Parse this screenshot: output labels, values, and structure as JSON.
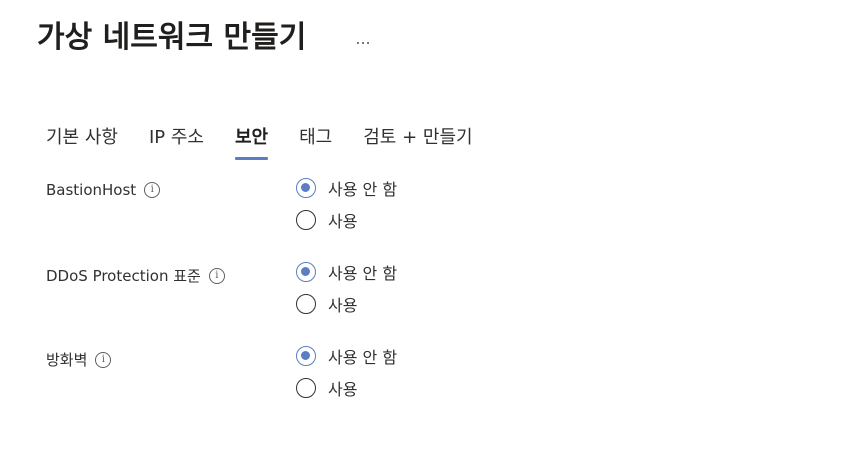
{
  "page": {
    "title": "가상 네트워크 만들기",
    "more_label": "..."
  },
  "tabs": [
    {
      "label": "기본 사항"
    },
    {
      "label": "IP 주소"
    },
    {
      "label": "보안"
    },
    {
      "label": "태그"
    },
    {
      "label": "검토 + 만들기"
    }
  ],
  "active_tab": "보안",
  "settings": [
    {
      "label": "BastionHost",
      "options": [
        {
          "label": "사용 안 함",
          "selected": true
        },
        {
          "label": "사용",
          "selected": false
        }
      ]
    },
    {
      "label": "DDoS Protection 표준",
      "options": [
        {
          "label": "사용 안 함",
          "selected": true
        },
        {
          "label": "사용",
          "selected": false
        }
      ]
    },
    {
      "label": "방화벽",
      "options": [
        {
          "label": "사용 안 함",
          "selected": true
        },
        {
          "label": "사용",
          "selected": false
        }
      ]
    }
  ],
  "icons": {
    "info": "info-icon",
    "more": "more-horizontal-icon"
  },
  "colors": {
    "accent": "#5b7dc6",
    "text": "#323130",
    "title": "#201f1e"
  }
}
